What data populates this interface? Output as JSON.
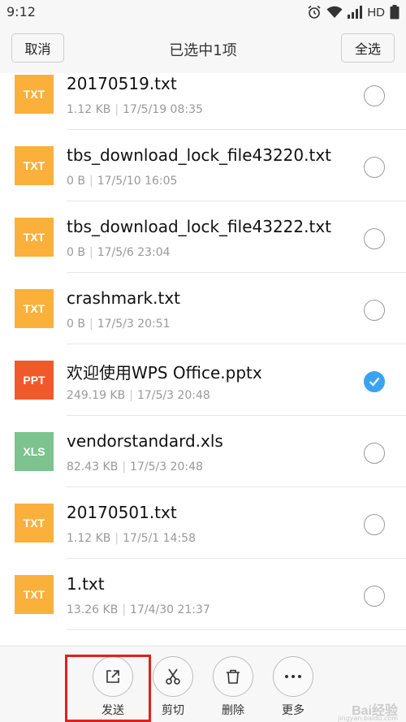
{
  "status_bar": {
    "time": "9:12",
    "network": "HD"
  },
  "header": {
    "cancel_label": "取消",
    "title": "已选中1项",
    "select_all_label": "全选"
  },
  "colors": {
    "txt": "#fbb03b",
    "ppt": "#f05a2a",
    "xls": "#7cc38f",
    "checked": "#3aa3f0",
    "highlight": "#e0201c"
  },
  "files": [
    {
      "type": "TXT",
      "name": "20170519.txt",
      "size": "1.12 KB",
      "date": "17/5/19 08:35",
      "checked": false
    },
    {
      "type": "TXT",
      "name": "tbs_download_lock_file43220.txt",
      "size": "0 B",
      "date": "17/5/10 16:05",
      "checked": false
    },
    {
      "type": "TXT",
      "name": "tbs_download_lock_file43222.txt",
      "size": "0 B",
      "date": "17/5/6 23:04",
      "checked": false
    },
    {
      "type": "TXT",
      "name": "crashmark.txt",
      "size": "0 B",
      "date": "17/5/3 20:51",
      "checked": false
    },
    {
      "type": "PPT",
      "name": "欢迎使用WPS  Office.pptx",
      "size": "249.19 KB",
      "date": "17/5/3 20:48",
      "checked": true
    },
    {
      "type": "XLS",
      "name": "vendorstandard.xls",
      "size": "82.43 KB",
      "date": "17/5/3 20:48",
      "checked": false
    },
    {
      "type": "TXT",
      "name": "20170501.txt",
      "size": "1.12 KB",
      "date": "17/5/1 14:58",
      "checked": false
    },
    {
      "type": "TXT",
      "name": "1.txt",
      "size": "13.26 KB",
      "date": "17/4/30 21:37",
      "checked": false
    }
  ],
  "actions": [
    {
      "label": "发送",
      "icon": "share-icon"
    },
    {
      "label": "剪切",
      "icon": "scissors-icon"
    },
    {
      "label": "删除",
      "icon": "trash-icon"
    },
    {
      "label": "更多",
      "icon": "more-icon"
    }
  ],
  "watermark": {
    "text": "Bai经验",
    "sub": "jingyan.baidu.com"
  }
}
